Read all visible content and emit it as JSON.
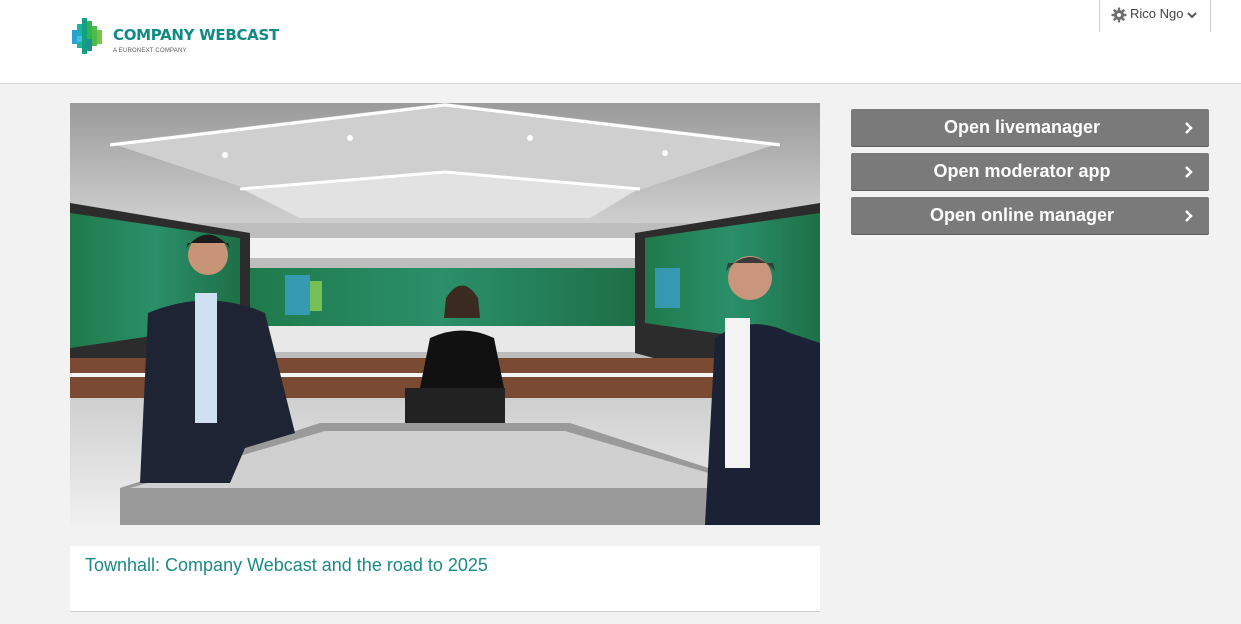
{
  "header": {
    "logo_title": "COMPANY WEBCAST",
    "logo_subtitle": "A EURONEXT COMPANY",
    "user_name": "Rico Ngo",
    "user_icon": "gear-icon",
    "menu_icon": "chevron-down-icon"
  },
  "event": {
    "title": "Townhall: Company Webcast and the road to 2025"
  },
  "actions": [
    {
      "label": "Open livemanager",
      "icon": "chevron-right-icon"
    },
    {
      "label": "Open moderator app",
      "icon": "chevron-right-icon"
    },
    {
      "label": "Open online manager",
      "icon": "chevron-right-icon"
    }
  ],
  "colors": {
    "brand": "#0f8a84",
    "title_link": "#1a8a86",
    "button_bg": "#7a7a7a"
  }
}
